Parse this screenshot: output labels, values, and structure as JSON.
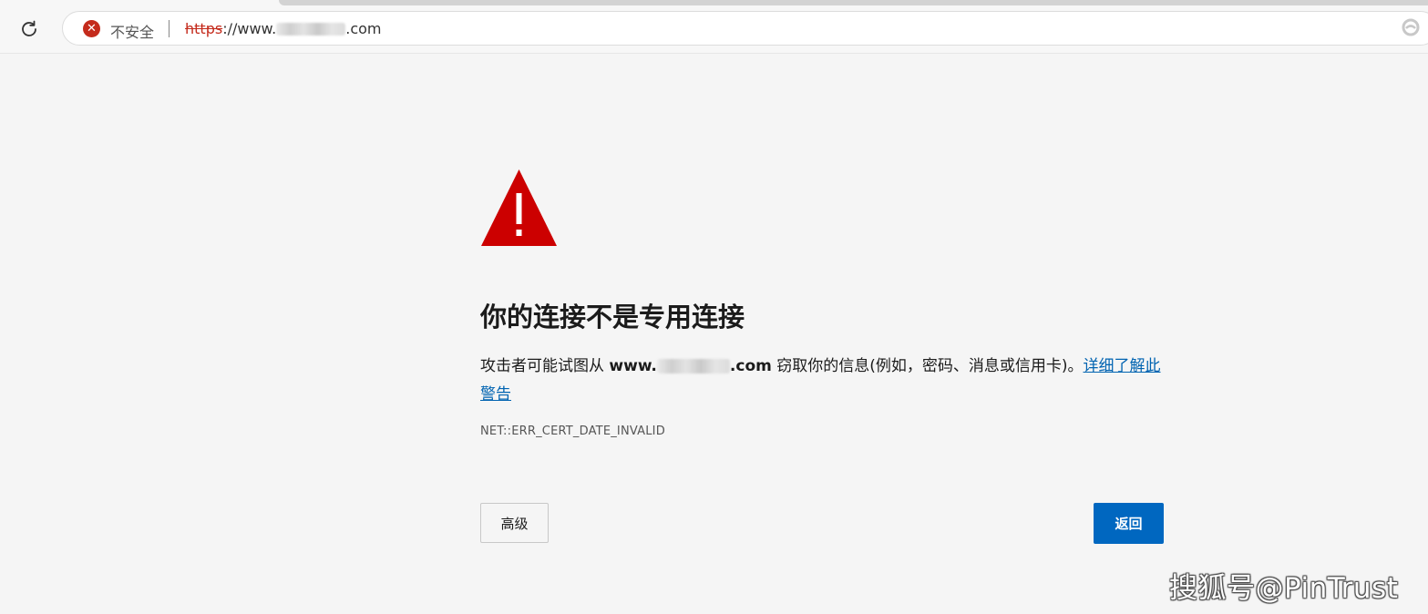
{
  "browser": {
    "security_label": "不安全",
    "security_icon": "x-circle-icon",
    "url_scheme": "https",
    "url_sep": "://",
    "url_prefix": "www.",
    "url_suffix": ".com",
    "reload_icon": "reload-icon",
    "edge_icon": "edge-icon"
  },
  "error_page": {
    "icon": "warning-triangle-icon",
    "icon_color": "#cc0000",
    "title": "你的连接不是专用连接",
    "desc_prefix": "攻击者可能试图从 ",
    "desc_domain_prefix": "www.",
    "desc_domain_suffix": ".com",
    "desc_middle": " 窃取你的信息(例如，密码、消息或信用卡)。",
    "learn_more_link": "详细了解此警告",
    "error_code": "NET::ERR_CERT_DATE_INVALID",
    "advanced_button": "高级",
    "back_button": "返回",
    "accent_color": "#0067c0"
  },
  "watermark": "搜狐号@PinTrust"
}
